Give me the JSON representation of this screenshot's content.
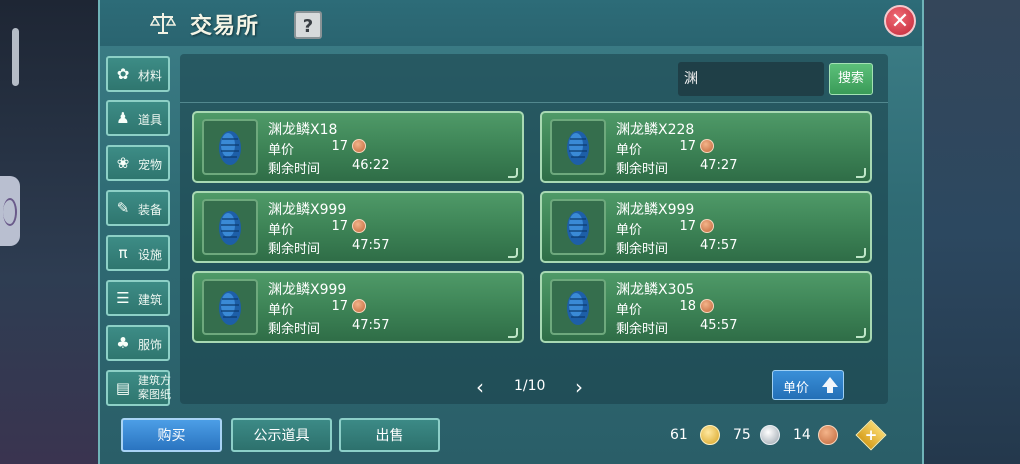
{
  "window": {
    "title": "交易所",
    "help_label": "?",
    "close_label": "✕"
  },
  "sidebar": {
    "items": [
      {
        "label": "材料",
        "icon": "materials-icon",
        "glyph": "✿"
      },
      {
        "label": "道具",
        "icon": "tools-icon",
        "glyph": "♟"
      },
      {
        "label": "宠物",
        "icon": "pet-paw-icon",
        "glyph": "❀"
      },
      {
        "label": "装备",
        "icon": "equipment-icon",
        "glyph": "✎"
      },
      {
        "label": "设施",
        "icon": "facility-icon",
        "glyph": "π"
      },
      {
        "label": "建筑",
        "icon": "building-icon",
        "glyph": "☰"
      },
      {
        "label": "服饰",
        "icon": "clothing-icon",
        "glyph": "♣"
      },
      {
        "label": "建筑方案图纸",
        "icon": "blueprint-icon",
        "glyph": "▤"
      }
    ]
  },
  "search": {
    "value": "渊",
    "button_label": "搜索"
  },
  "listings": [
    {
      "name": "渊龙鳞X18",
      "price_label": "单价",
      "price": "17",
      "time_label": "剩余时间",
      "time": "46:22"
    },
    {
      "name": "渊龙鳞X228",
      "price_label": "单价",
      "price": "17",
      "time_label": "剩余时间",
      "time": "47:27"
    },
    {
      "name": "渊龙鳞X999",
      "price_label": "单价",
      "price": "17",
      "time_label": "剩余时间",
      "time": "47:57"
    },
    {
      "name": "渊龙鳞X999",
      "price_label": "单价",
      "price": "17",
      "time_label": "剩余时间",
      "time": "47:57"
    },
    {
      "name": "渊龙鳞X999",
      "price_label": "单价",
      "price": "17",
      "time_label": "剩余时间",
      "time": "47:57"
    },
    {
      "name": "渊龙鳞X305",
      "price_label": "单价",
      "price": "18",
      "time_label": "剩余时间",
      "time": "45:57"
    }
  ],
  "pager": {
    "prev": "‹",
    "text": "1/10",
    "next": "›"
  },
  "sort": {
    "label": "单价"
  },
  "actions": {
    "buy": "购买",
    "public": "公示道具",
    "sell": "出售"
  },
  "currency": {
    "gold": "61",
    "silver": "75",
    "copper": "14",
    "add": "+"
  },
  "colors": {
    "panel": "#2f6b74",
    "card": "#3c8255",
    "buy_button": "#2a74c0",
    "close_button": "#c2283a"
  }
}
